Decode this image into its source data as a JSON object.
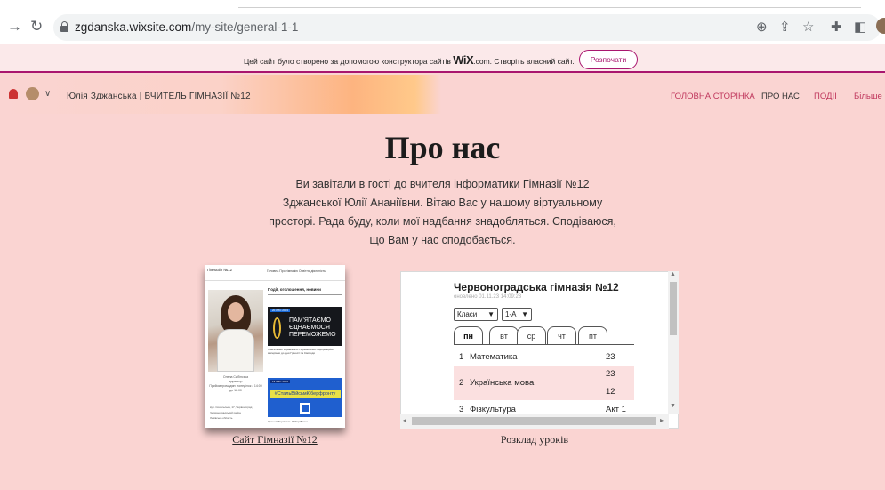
{
  "browser": {
    "url_host": "zgdanska.wixsite.com",
    "url_path": "/my-site/general-1-1",
    "back_icon": "arrow-right-icon",
    "reload_icon": "reload-icon",
    "icons": [
      "zoom-icon",
      "share-icon",
      "star-icon",
      "extensions-icon",
      "sidebar-icon",
      "profile-avatar"
    ]
  },
  "wix_banner": {
    "text_before": "Цей сайт було створено за допомогою конструктора сайтів ",
    "brand": "WiX",
    "text_after": ".com. Створіть власний сайт.",
    "cta": "Розпочати"
  },
  "header": {
    "site_title": "Юлія Зджанська | ВЧИТЕЛЬ ГІМНАЗІЇ №12",
    "menu": [
      {
        "label": "ГОЛОВНА СТОРІНКА",
        "color": "#c0395e"
      },
      {
        "label": "ПРО НАС",
        "color": "#333333"
      },
      {
        "label": "ПОДІЇ",
        "color": "#c0395e"
      },
      {
        "label": "Більше",
        "color": "#c0395e"
      }
    ]
  },
  "main": {
    "title": "Про нас",
    "intro": "Ви завітали в гості до вчителя інформатики Гімназії №12 Зджанської  Юлії Ананіївни. Вітаю Вас у нашому віртуальному просторі. Рада буду, коли мої надбання знадобляться. Сподіваюся, що Вам у нас сподобається."
  },
  "site_card": {
    "label": "Сайт Гімназії №12",
    "thumb": {
      "head": "Гімназія №12",
      "nav": "Головна   Про гімназію   Освітня діяльність",
      "news_title": "Події, оголошення, новини",
      "banner1_date": "20 ЛИС 2023",
      "banner1_text": "ПАМ'ЯТАЄМО\nЄДНАЄМОСЯ\nПЕРЕМОЖЕМО",
      "banner1_caption": "Пам'ятаємо! Єднаємося! Переможемо! Інформаційні матеріали до Дня Гідності та Свободи",
      "banner2_date": "16 ЛИС 2023",
      "banner2_tag": "#СтальВійсьмКіберфронту",
      "banner2_caption": "Урок з Кібергігієни. #КіберФронт",
      "left_name": "Олена Скібінська",
      "left_role": "директор",
      "left_hours": "Прийом громадян: понеділок з 14:00 до 16:00",
      "left_address": "вул. Сокальська, 17, Червоноград\nЧервоноградський район\nЛьвівська область"
    }
  },
  "schedule": {
    "label": "Розклад уроків",
    "school": "Червоноградська гімназія №12",
    "updated": "оновлено 01.11.23 14:09:23",
    "class_select": "Класи",
    "grade_select": "1-А",
    "days": [
      "пн",
      "вт",
      "ср",
      "чт",
      "пт"
    ],
    "active_day": "пн",
    "lessons": [
      {
        "num": "1",
        "subject": "Математика",
        "room": "23"
      },
      {
        "num": "2",
        "subject": "Українська мова",
        "room": "23",
        "room2": "12"
      },
      {
        "num": "3",
        "subject": "Фізкультура",
        "room": "Акт 1"
      }
    ]
  }
}
